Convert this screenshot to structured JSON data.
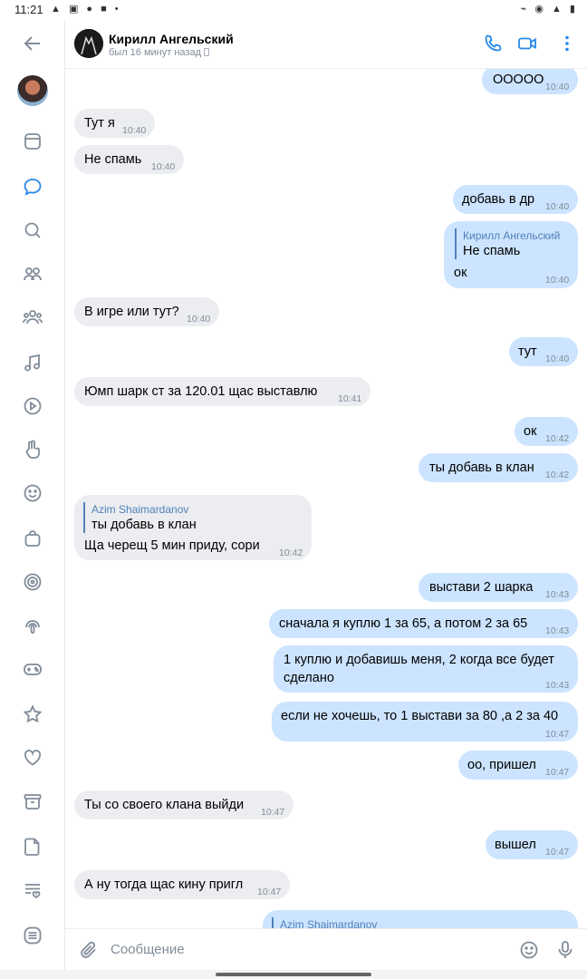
{
  "status": {
    "time": "11:21",
    "left_icons": "▲ ▣ ● ■ •",
    "right_icons": "⌁ ◉ ▲ ▮"
  },
  "sidebar": {
    "items": [
      {
        "icon": "back-arrow-icon"
      },
      {
        "icon": "avatar"
      },
      {
        "icon": "news-icon"
      },
      {
        "icon": "messages-icon",
        "active": true
      },
      {
        "icon": "search-icon"
      },
      {
        "icon": "friends-icon"
      },
      {
        "icon": "communities-icon"
      },
      {
        "icon": "music-icon"
      },
      {
        "icon": "video-icon"
      },
      {
        "icon": "clips-icon"
      },
      {
        "icon": "stickers-icon"
      },
      {
        "icon": "shop-icon"
      },
      {
        "icon": "target-icon"
      },
      {
        "icon": "podcasts-icon"
      },
      {
        "icon": "games-icon"
      },
      {
        "icon": "bookmarks-icon"
      },
      {
        "icon": "likes-icon"
      },
      {
        "icon": "archive-icon"
      },
      {
        "icon": "documents-icon"
      },
      {
        "icon": "lists-icon"
      },
      {
        "icon": "menu-icon"
      }
    ]
  },
  "header": {
    "name": "Кирилл Ангельский",
    "seen": "был 16 минут назад",
    "accent": "#2688eb"
  },
  "messages": [
    {
      "dir": "out",
      "text": "ООООО",
      "time": "10:40"
    },
    {
      "dir": "in",
      "text": "Тут я",
      "time": "10:40"
    },
    {
      "dir": "in",
      "text": "Не спамь",
      "time": "10:40"
    },
    {
      "dir": "out",
      "text": "добавь в др",
      "time": "10:40"
    },
    {
      "dir": "out",
      "reply_name": "Кирилл Ангельский",
      "reply_text": "Не спамь",
      "text": "ок",
      "time": "10:40"
    },
    {
      "dir": "in",
      "text": "В игре или тут?",
      "time": "10:40"
    },
    {
      "dir": "out",
      "text": "тут",
      "time": "10:40"
    },
    {
      "dir": "in",
      "text": "Юмп шарк ст за 120.01 щас выставлю",
      "time": "10:41"
    },
    {
      "dir": "out",
      "text": "ок",
      "time": "10:42"
    },
    {
      "dir": "out",
      "text": "ты добавь в клан",
      "time": "10:42"
    },
    {
      "dir": "in",
      "reply_name": "Azim Shaimardanov",
      "reply_text": "ты добавь в клан",
      "text": "Ща черещ 5 мин приду, сори",
      "time": "10:42"
    },
    {
      "dir": "out",
      "text": "выстави 2 шарка",
      "time": "10:43"
    },
    {
      "dir": "out",
      "text": "сначала я куплю 1 за 65, а потом 2 за 65",
      "time": "10:43"
    },
    {
      "dir": "out",
      "text": "1 куплю и добавишь меня, 2 когда все будет",
      "text2": "сделано",
      "time": "10:43"
    },
    {
      "dir": "out",
      "text": "если не хочешь, то 1 выстави за 80 ,а 2 за 40",
      "time": "10:47"
    },
    {
      "dir": "out",
      "text": "оо, пришел",
      "time": "10:47"
    },
    {
      "dir": "in",
      "text": "Ты со своего клана выйди",
      "time": "10:47"
    },
    {
      "dir": "out",
      "text": "вышел",
      "time": "10:47"
    },
    {
      "dir": "in",
      "text": "А ну тогда щас кину пригл",
      "time": "10:47"
    },
    {
      "dir": "out",
      "reply_name": "Azim Shaimardanov",
      "reply_text": "",
      "text": "",
      "time": ""
    }
  ],
  "input": {
    "placeholder": "Сообщение"
  }
}
